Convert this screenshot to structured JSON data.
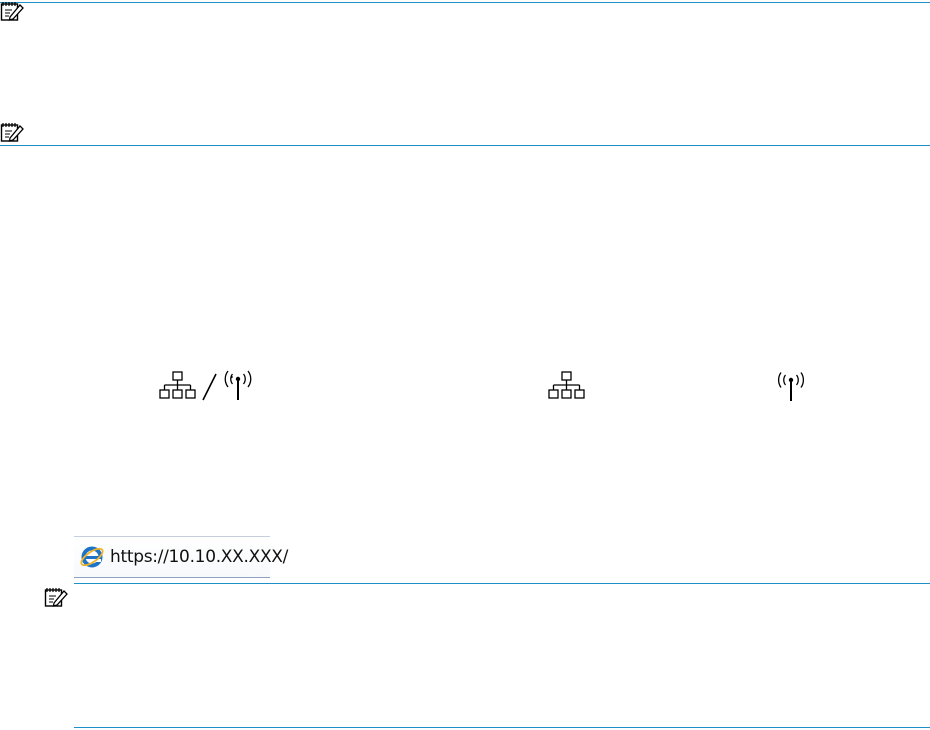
{
  "address_bar": {
    "url": "https://10.10.XX.XXX/",
    "browser_icon": "internet-explorer-icon"
  },
  "icons": {
    "note": "note-icon",
    "wired_or_wireless": "ethernet-wireless-icon",
    "wired": "ethernet-icon",
    "wireless": "wireless-icon"
  },
  "colors": {
    "rule": "#1f8fc8",
    "ie_blue": "#1e73c8",
    "ie_ring": "#f0b428"
  }
}
